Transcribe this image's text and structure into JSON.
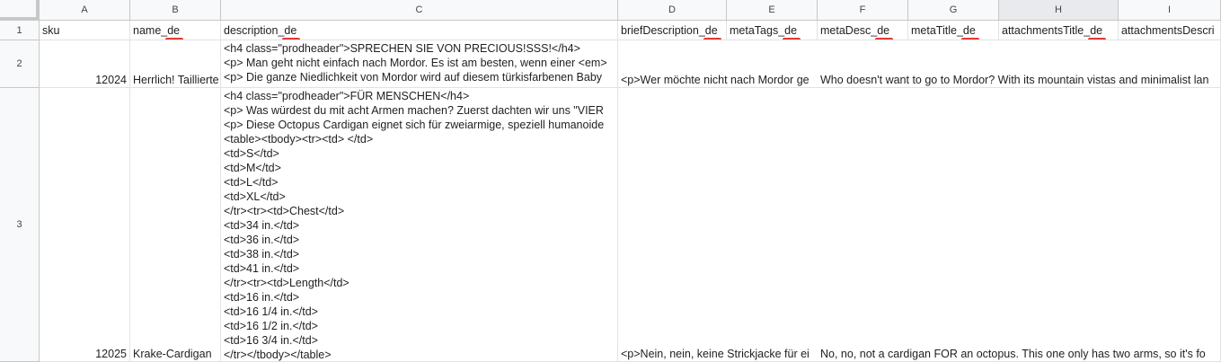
{
  "columns": [
    "A",
    "B",
    "C",
    "D",
    "E",
    "F",
    "G",
    "H",
    "I"
  ],
  "rows": [
    "1",
    "2",
    "3"
  ],
  "headers": {
    "sku": "sku",
    "name_pre": "name_",
    "name_de": "de",
    "desc_pre": "description_",
    "desc_de": "de",
    "brief_pre": "briefDescription_",
    "brief_de": "de",
    "tags_pre": "metaTags_",
    "tags_de": "de",
    "mdesc_pre": "metaDesc_",
    "mdesc_de": "de",
    "mtitle_pre": "metaTitle_",
    "mtitle_de": "de",
    "atitle_pre": "attachmentsTitle_",
    "atitle_de": "de",
    "adesc": "attachmentsDescri"
  },
  "row2": {
    "sku": "12024",
    "name": "Herrlich! Taillierte",
    "desc": "<h4 class=\"prodheader\">SPRECHEN SIE VON PRECIOUS!SSS!</h4>\n<p> Man geht nicht einfach nach Mordor. Es ist am besten, wenn einer <em>\n<p> Die ganze Niedlichkeit von Mordor wird auf diesem türkisfarbenen Baby",
    "brief": "<p>Wer möchte nicht nach Mordor ge",
    "metadesc": "Who doesn't want to go to Mordor? With its mountain vistas and minimalist lan"
  },
  "row3": {
    "sku": "12025",
    "name": "Krake-Cardigan",
    "desc": "<h4 class=\"prodheader\">FÜR MENSCHEN</h4>\n<p> Was würdest du mit acht Armen machen? Zuerst dachten wir uns \"VIER\n<p> Diese Octopus Cardigan eignet sich für zweiarmige, speziell humanoide\n<table><tbody><tr><td> </td>\n<td>S</td>\n<td>M</td>\n<td>L</td>\n<td>XL</td>\n</tr><tr><td>Chest</td>\n<td>34 in.</td>\n<td>36 in.</td>\n<td>38 in.</td>\n<td>41 in.</td>\n</tr><tr><td>Length</td>\n<td>16 in.</td>\n<td>16 1/4 in.</td>\n<td>16 1/2 in.</td>\n<td>16 3/4 in.</td>\n</tr></tbody></table>",
    "brief": "<p>Nein, nein, keine Strickjacke für ei",
    "metadesc": "No, no, not a cardigan FOR an octopus. This one only has two arms, so it's fo"
  }
}
